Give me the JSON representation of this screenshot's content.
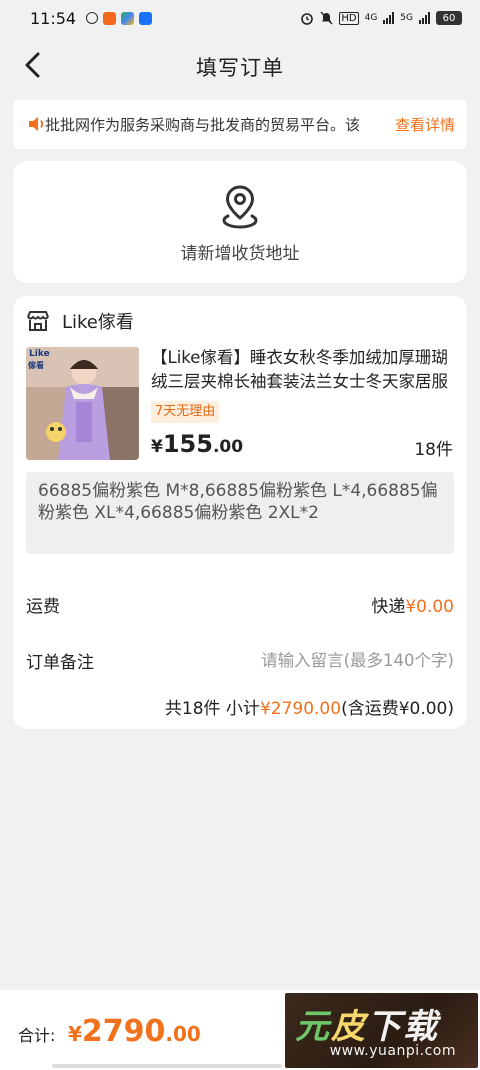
{
  "status_bar": {
    "time": "11:54",
    "network_1": "HD",
    "network_2": "4G",
    "network_3": "5G",
    "battery": "60"
  },
  "nav": {
    "title": "填写订单",
    "back_icon": "chevron-left-icon"
  },
  "notice": {
    "text": "批批网作为服务采购商与批发商的贸易平台。该",
    "link": "查看详情",
    "icon": "speaker-icon"
  },
  "address": {
    "label": "请新增收货地址",
    "icon": "location-pin-icon"
  },
  "order": {
    "shop_name": "Like傢看",
    "shop_icon": "store-icon",
    "product": {
      "thumb_brand": "Like",
      "thumb_brand_2": "傢看",
      "title": "【Like傢看】睡衣女秋冬季加绒加厚珊瑚绒三层夹棉长袖套装法兰女士冬天家居服",
      "return_badge": "7天无理由",
      "price_currency": "¥",
      "price_int": "155",
      "price_dec": ".00",
      "quantity": "18件"
    },
    "specs": "66885偏粉紫色 M*8,66885偏粉紫色 L*4,66885偏粉紫色 XL*4,66885偏粉紫色 2XL*2",
    "shipping": {
      "label": "运费",
      "method": "快递",
      "amount": "¥0.00"
    },
    "remark": {
      "label": "订单备注",
      "placeholder": "请输入留言(最多140个字)",
      "value": ""
    },
    "subtotal": {
      "prefix": "共18件 小计",
      "amount": "¥2790.00",
      "suffix": "(含运费¥0.00)"
    }
  },
  "footer": {
    "total_label": "合计:",
    "total_currency": "¥",
    "total_int": "2790",
    "total_dec": ".00"
  },
  "watermark": {
    "char_1": "元",
    "char_2": "皮",
    "char_3": "下载",
    "url": "www.yuanpi.com"
  },
  "colors": {
    "accent": "#f2711c",
    "background": "#f1f1f1",
    "card": "#ffffff"
  }
}
